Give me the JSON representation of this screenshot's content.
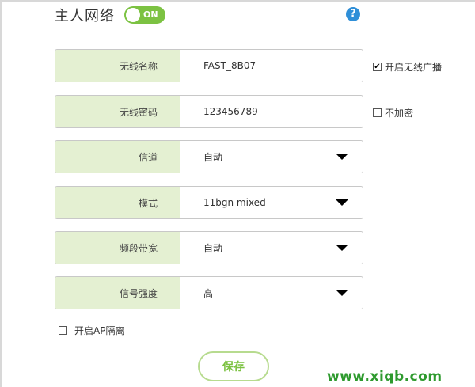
{
  "header": {
    "title": "主人网络",
    "toggle_state": "ON",
    "help_label": "?"
  },
  "form": {
    "rows": [
      {
        "label": "无线名称",
        "value": "FAST_8B07"
      },
      {
        "label": "无线密码",
        "value": "123456789"
      },
      {
        "label": "信道",
        "value": "自动"
      },
      {
        "label": "模式",
        "value": "11bgn mixed"
      },
      {
        "label": "频段带宽",
        "value": "自动"
      },
      {
        "label": "信号强度",
        "value": "高"
      }
    ]
  },
  "options": {
    "broadcast": {
      "label": "开启无线广播",
      "checked_mark": "✔"
    },
    "no_encrypt": {
      "label": "不加密"
    },
    "ap_isolation": {
      "label": "开启AP隔离"
    }
  },
  "actions": {
    "save_label": "保存"
  },
  "watermark": "www.xiqb.com",
  "colors": {
    "accent": "#7cc242",
    "label_bg": "#e4f0d2",
    "help": "#2f8fd8"
  }
}
